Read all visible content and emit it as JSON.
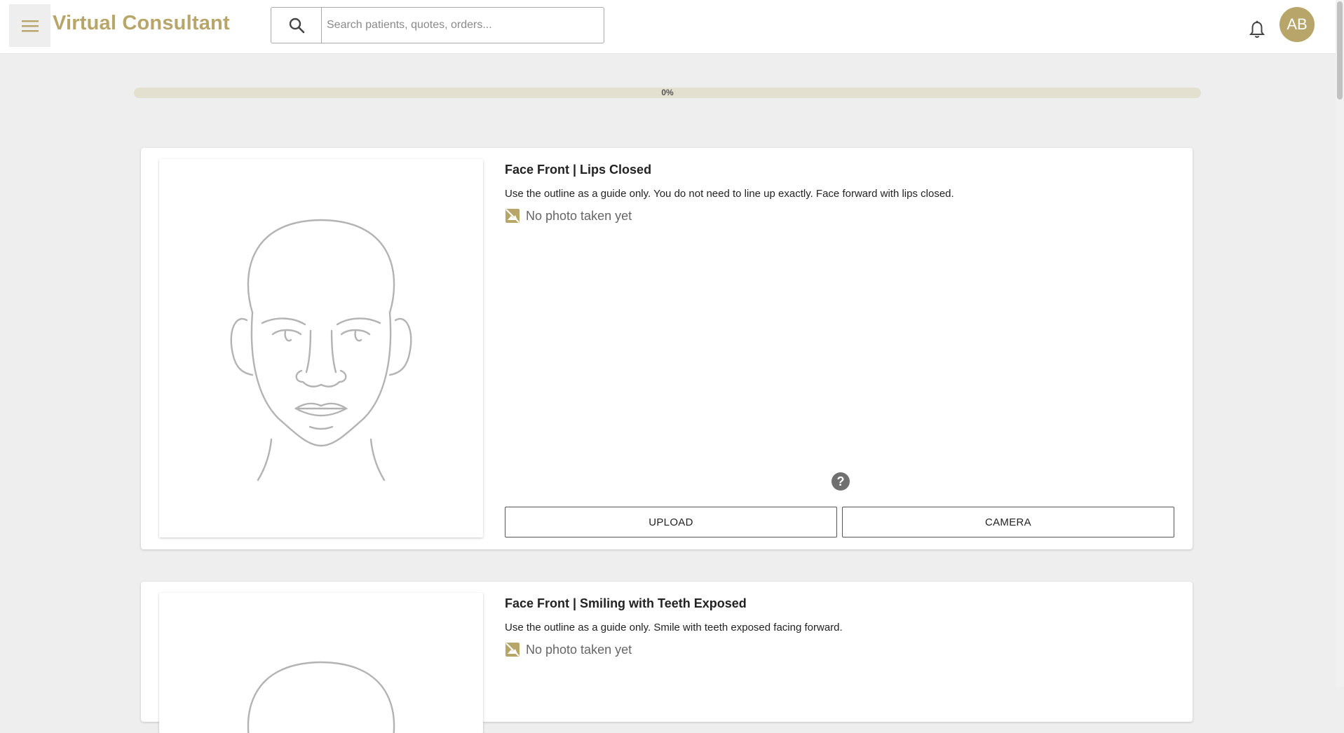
{
  "header": {
    "app_title": "Virtual Consultant",
    "search_placeholder": "Search patients, quotes, orders...",
    "avatar_initials": "AB",
    "icons": [
      "menu-icon",
      "search-icon",
      "bell-icon"
    ]
  },
  "progress": {
    "value": 0,
    "label": "0%"
  },
  "cards": [
    {
      "title": "Face Front | Lips Closed",
      "description": "Use the outline as a guide only. You do not need to line up exactly. Face forward with lips closed.",
      "status": "No photo taken yet",
      "upload_label": "UPLOAD",
      "camera_label": "CAMERA",
      "help_label": "?"
    },
    {
      "title": "Face Front | Smiling with Teeth Exposed",
      "description": "Use the outline as a guide only. Smile with teeth exposed facing forward.",
      "status": "No photo taken yet"
    }
  ],
  "colors": {
    "accent": "#b7a56a",
    "background": "#eeeeee",
    "progress_track": "#e4e0cf"
  }
}
